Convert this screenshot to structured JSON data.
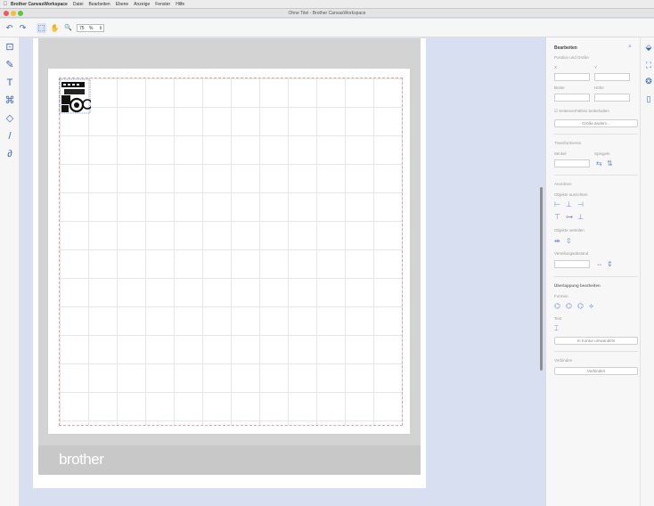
{
  "menubar": {
    "apple": "",
    "app_name": "Brother CanvasWorkspace",
    "items": [
      "Datei",
      "Bearbeiten",
      "Ebene",
      "Anzeige",
      "Fenster",
      "Hilfe"
    ]
  },
  "window": {
    "title": "Ohne Titel - Brother CanvasWorkspace"
  },
  "toolbar": {
    "undo_icon": "↶",
    "redo_icon": "↷",
    "select_icon": "⬚",
    "pan_icon": "✋",
    "zoom_icon": "🔍",
    "zoom_value": "75",
    "zoom_unit": "%"
  },
  "left_tools": [
    "⊡",
    "✎",
    "T",
    "⌘",
    "◇",
    "/",
    "∂"
  ],
  "canvas": {
    "brand": "brother"
  },
  "panel": {
    "title": "Bearbeiten",
    "position_size": "Position und Größe",
    "x_label": "X",
    "y_label": "Y",
    "width_label": "Breite",
    "height_label": "Höhe",
    "keep_ratio": "Seitenverhältnis beibehalten",
    "size_button": "Größe ändern...",
    "transform": "Transformieren",
    "angle_label": "Winkel",
    "flip_label": "Spiegeln",
    "arrange": "Anordnen",
    "align_label": "Objekte ausrichten",
    "distribute_label": "Objekte verteilen",
    "spacing_label": "Verteilungsabstand",
    "edit_overlap": "Überlappung bearbeiten",
    "shape_label": "Formen",
    "text_label": "Text",
    "text_button": "In Kontur umwandeln",
    "connect": "Verbinden",
    "connect_button": "Verbinden"
  }
}
